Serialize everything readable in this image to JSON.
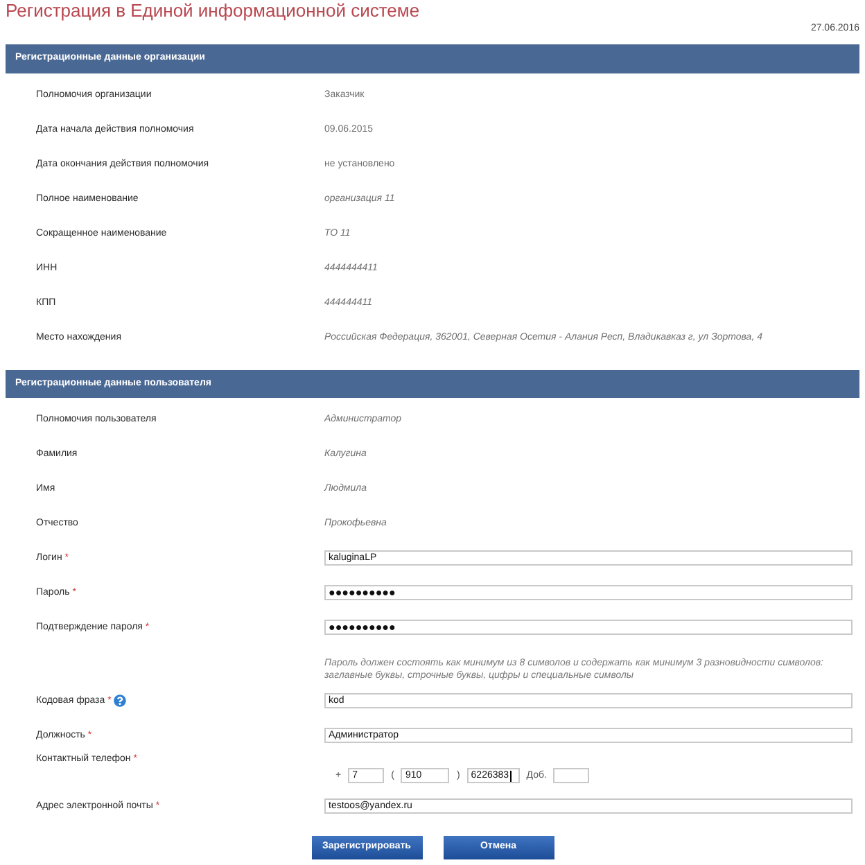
{
  "page": {
    "title": "Регистрация в Единой информационной системе",
    "date": "27.06.2016"
  },
  "sections": [
    {
      "title": "Регистрационные данные организации",
      "rows": [
        {
          "kind": "info",
          "label": "Полномочия организации",
          "value": "Заказчик",
          "italic": false
        },
        {
          "kind": "info",
          "label": "Дата начала действия полномочия",
          "value": "09.06.2015",
          "italic": false
        },
        {
          "kind": "info",
          "label": "Дата окончания действия полномочия",
          "value": "не установлено",
          "italic": false
        },
        {
          "kind": "info",
          "label": "Полное наименование",
          "value": "организация 11",
          "italic": true
        },
        {
          "kind": "info",
          "label": "Сокращенное наименование",
          "value": "ТО 11",
          "italic": true
        },
        {
          "kind": "info",
          "label": "ИНН",
          "value": "4444444411",
          "italic": true
        },
        {
          "kind": "info",
          "label": "КПП",
          "value": "444444411",
          "italic": true
        },
        {
          "kind": "info",
          "label": "Место нахождения",
          "value": "Российская Федерация, 362001, Северная Осетия - Алания Респ, Владикавказ г, ул Зортова, 4",
          "italic": true
        }
      ]
    },
    {
      "title": "Регистрационные данные пользователя",
      "rows": [
        {
          "kind": "info",
          "label": "Полномочия пользователя",
          "value": "Администратор",
          "italic": true
        },
        {
          "kind": "info",
          "label": "Фамилия",
          "value": "Калугина",
          "italic": true
        },
        {
          "kind": "info",
          "label": "Имя",
          "value": "Людмила",
          "italic": true
        },
        {
          "kind": "info",
          "label": "Отчество",
          "value": "Прокофьевна",
          "italic": true
        },
        {
          "kind": "text",
          "label": "Логин",
          "mark": "*",
          "value": "kaluginaLP"
        },
        {
          "kind": "password",
          "label": "Пароль",
          "mark": "*",
          "value": "●●●●●●●●●●"
        },
        {
          "kind": "password",
          "label": "Подтверждение пароля",
          "mark": "*",
          "value": "●●●●●●●●●●"
        },
        {
          "kind": "note",
          "text": "Пароль должен состоять как минимум из 8 символов и содержать как минимум 3 разновидности символов: заглавные буквы, строчные буквы, цифры и специальные символы"
        },
        {
          "kind": "text",
          "label": "Кодовая фраза",
          "mark": "*",
          "help": true,
          "value": "kod"
        },
        {
          "kind": "text",
          "label": "Должность",
          "mark": "*",
          "value": "Администратор"
        },
        {
          "kind": "phone",
          "label": "Контактный телефон",
          "mark": "*",
          "parts": [
            {
              "kind": "text",
              "text": "+"
            },
            {
              "kind": "input",
              "value": "7",
              "focused": false
            },
            {
              "kind": "text",
              "text": "("
            },
            {
              "kind": "input",
              "value": "910",
              "focused": false
            },
            {
              "kind": "text",
              "text": ")"
            },
            {
              "kind": "input",
              "value": "6226383",
              "focused": true
            },
            {
              "kind": "text",
              "text": "Доб."
            },
            {
              "kind": "input",
              "focused": false
            }
          ]
        },
        {
          "kind": "text",
          "label": "Адрес электронной почты",
          "mark": "*",
          "value": "testoos@yandex.ru"
        }
      ]
    }
  ],
  "buttons": [
    {
      "label": "Зарегистрировать"
    },
    {
      "label": "Отмена"
    }
  ]
}
